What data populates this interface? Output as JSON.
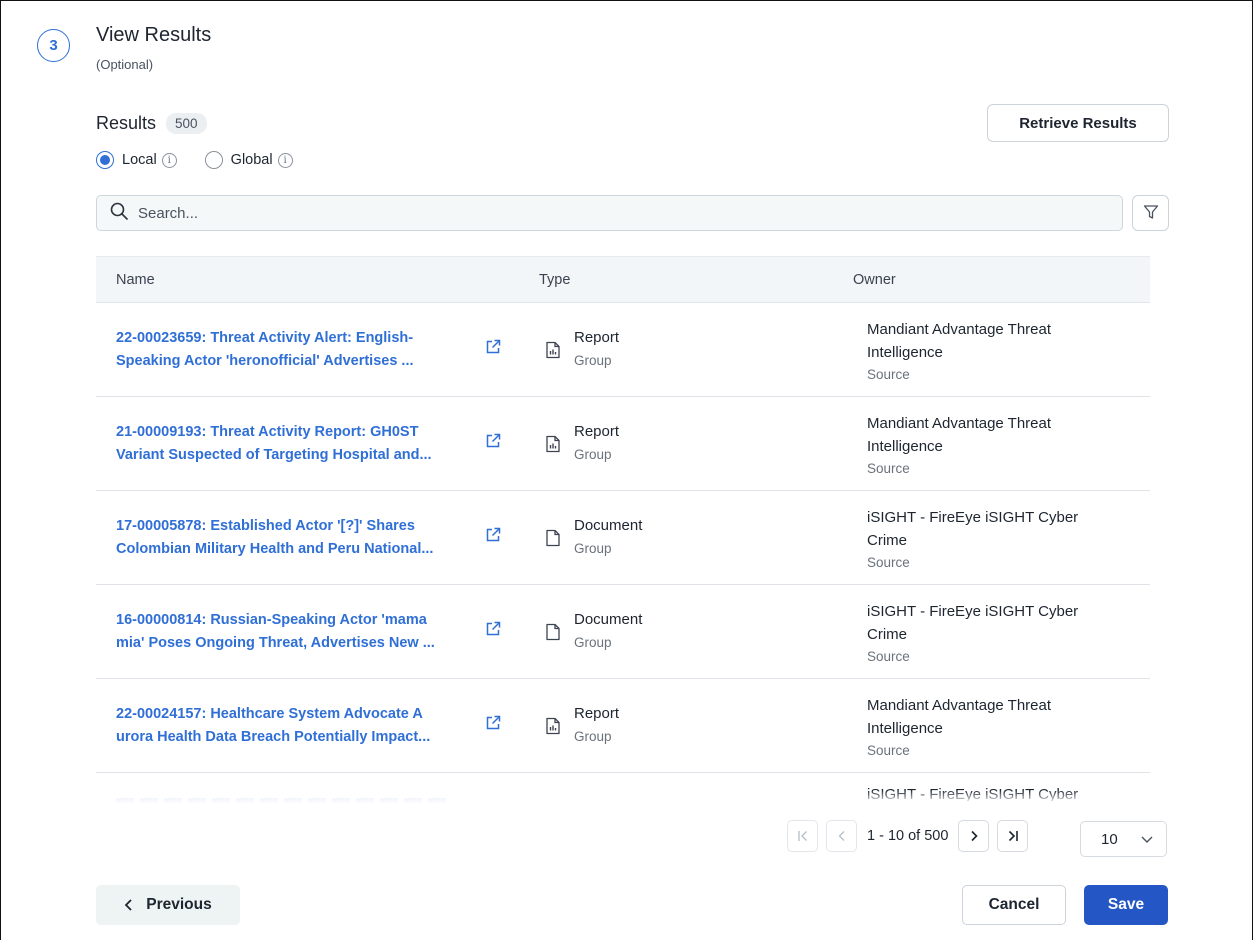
{
  "step": {
    "number": "3",
    "title": "View Results",
    "subtitle": "(Optional)"
  },
  "results": {
    "title": "Results",
    "count": "500",
    "retrieve_label": "Retrieve Results",
    "scope_options": [
      {
        "label": "Local",
        "selected": true
      },
      {
        "label": "Global",
        "selected": false
      }
    ]
  },
  "search": {
    "placeholder": "Search..."
  },
  "table": {
    "columns": [
      "Name",
      "Type",
      "Owner"
    ],
    "rows": [
      {
        "name_line1": "22-00023659: Threat Activity Alert: English-",
        "name_line2": "Speaking Actor 'heronofficial' Advertises ...",
        "type": "Report",
        "type_sub": "Group",
        "type_icon": "report-icon",
        "owner": "Mandiant Advantage Threat Intelligence",
        "owner_sub": "Source"
      },
      {
        "name_line1": "21-00009193: Threat Activity Report: GH0ST",
        "name_line2": "Variant Suspected of Targeting Hospital and...",
        "type": "Report",
        "type_sub": "Group",
        "type_icon": "report-icon",
        "owner": "Mandiant Advantage Threat Intelligence",
        "owner_sub": "Source"
      },
      {
        "name_line1": "17-00005878: Established Actor '[?]' Shares",
        "name_line2": "Colombian Military Health and Peru National...",
        "type": "Document",
        "type_sub": "Group",
        "type_icon": "document-icon",
        "owner": "iSIGHT - FireEye iSIGHT Cyber Crime",
        "owner_sub": "Source"
      },
      {
        "name_line1": "16-00000814: Russian-Speaking Actor 'mama",
        "name_line2": "mia' Poses Ongoing Threat, Advertises New ...",
        "type": "Document",
        "type_sub": "Group",
        "type_icon": "document-icon",
        "owner": "iSIGHT - FireEye iSIGHT Cyber Crime",
        "owner_sub": "Source"
      },
      {
        "name_line1": "22-00024157: Healthcare System Advocate A",
        "name_line2": "urora Health Data Breach Potentially Impact...",
        "type": "Report",
        "type_sub": "Group",
        "type_icon": "report-icon",
        "owner": "Mandiant Advantage Threat Intelligence",
        "owner_sub": "Source"
      }
    ],
    "partial_row_owner": "iSIGHT - FireEye iSIGHT Cyber"
  },
  "pagination": {
    "range_text": "1 - 10 of 500",
    "page_size": "10"
  },
  "footer": {
    "previous_label": "Previous",
    "cancel_label": "Cancel",
    "save_label": "Save"
  },
  "colors": {
    "accent": "#2f6fd6",
    "primary_button": "#2457c5"
  }
}
